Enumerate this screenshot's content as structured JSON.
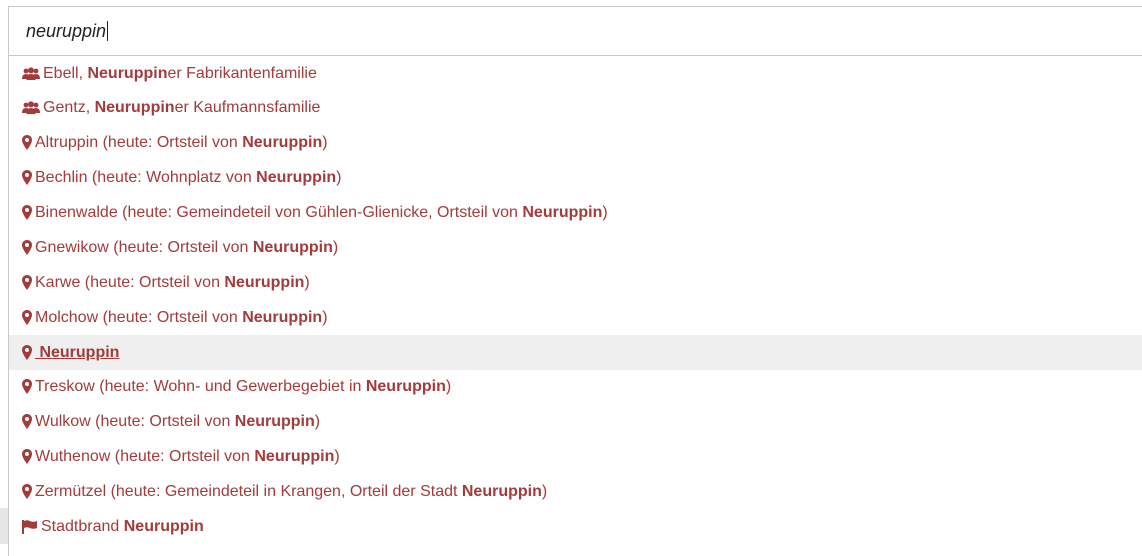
{
  "search": {
    "value": "neuruppin"
  },
  "suggestions": [
    {
      "icon": "group-icon",
      "pre": "Ebell, ",
      "match": "Neuruppin",
      "post": "er Fabrikantenfamilie"
    },
    {
      "icon": "group-icon",
      "pre": "Gentz, ",
      "match": "Neuruppin",
      "post": "er Kaufmannsfamilie"
    },
    {
      "icon": "map-marker-icon",
      "pre": "Altruppin (heute: Ortsteil von ",
      "match": "Neuruppin",
      "post": ")"
    },
    {
      "icon": "map-marker-icon",
      "pre": "Bechlin (heute: Wohnplatz von ",
      "match": "Neuruppin",
      "post": ")"
    },
    {
      "icon": "map-marker-icon",
      "pre": "Binenwalde (heute: Gemeindeteil von Gühlen-Glienicke, Ortsteil von ",
      "match": "Neuruppin",
      "post": ")"
    },
    {
      "icon": "map-marker-icon",
      "pre": "Gnewikow (heute: Ortsteil von ",
      "match": "Neuruppin",
      "post": ")"
    },
    {
      "icon": "map-marker-icon",
      "pre": "Karwe (heute: Ortsteil von ",
      "match": "Neuruppin",
      "post": ")"
    },
    {
      "icon": "map-marker-icon",
      "pre": "Molchow (heute: Ortsteil von ",
      "match": "Neuruppin",
      "post": ")"
    },
    {
      "icon": "map-marker-icon",
      "pre": " ",
      "match": "Neuruppin",
      "post": ""
    },
    {
      "icon": "map-marker-icon",
      "pre": "Treskow (heute: Wohn- und Gewerbegebiet in ",
      "match": "Neuruppin",
      "post": ")"
    },
    {
      "icon": "map-marker-icon",
      "pre": "Wulkow (heute: Ortsteil von ",
      "match": "Neuruppin",
      "post": ")"
    },
    {
      "icon": "map-marker-icon",
      "pre": "Wuthenow (heute: Ortsteil von ",
      "match": "Neuruppin",
      "post": ")"
    },
    {
      "icon": "map-marker-icon",
      "pre": "Zermützel (heute: Gemeindeteil in Krangen, Orteil der Stadt ",
      "match": "Neuruppin",
      "post": ")"
    },
    {
      "icon": "flag-icon",
      "pre": "Stadtbrand ",
      "match": "Neuruppin",
      "post": ""
    }
  ],
  "colors": {
    "link": "#a23b3b",
    "highlight_bg": "#efefef"
  }
}
